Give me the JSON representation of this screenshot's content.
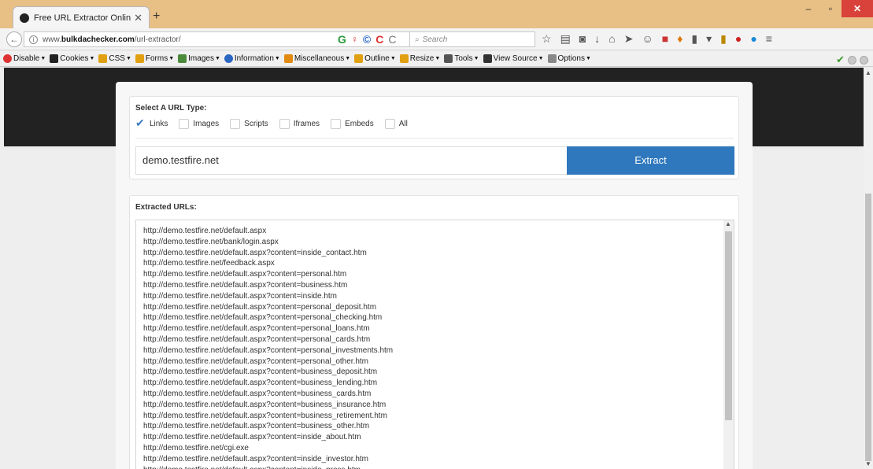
{
  "browser": {
    "tab_title": "Free URL Extractor Online ...",
    "new_tab": "+",
    "url_prefix": "www.",
    "url_domain": "bulkdachecker.com",
    "url_path": "/url-extractor/",
    "search_placeholder": "Search",
    "url_icons": [
      "G",
      "♀",
      "©",
      "C",
      "C"
    ],
    "window_controls": {
      "minimize": "–",
      "restore": "▫",
      "close": "✕"
    }
  },
  "devbar": {
    "items": [
      {
        "label": "Disable",
        "color": "#d33"
      },
      {
        "label": "Cookies",
        "color": "#222"
      },
      {
        "label": "CSS",
        "color": "#e0a010"
      },
      {
        "label": "Forms",
        "color": "#e0a010"
      },
      {
        "label": "Images",
        "color": "#4a8a3a"
      },
      {
        "label": "Information",
        "color": "#2a66c2"
      },
      {
        "label": "Miscellaneous",
        "color": "#e08a10"
      },
      {
        "label": "Outline",
        "color": "#e0a010"
      },
      {
        "label": "Resize",
        "color": "#e0a010"
      },
      {
        "label": "Tools",
        "color": "#555"
      },
      {
        "label": "View Source",
        "color": "#333"
      },
      {
        "label": "Options",
        "color": "#888"
      }
    ]
  },
  "extractor": {
    "type_label": "Select A URL Type:",
    "types": [
      {
        "label": "Links",
        "checked": true
      },
      {
        "label": "Images",
        "checked": false
      },
      {
        "label": "Scripts",
        "checked": false
      },
      {
        "label": "Iframes",
        "checked": false
      },
      {
        "label": "Embeds",
        "checked": false
      },
      {
        "label": "All",
        "checked": false
      }
    ],
    "input_value": "demo.testfire.net",
    "extract_label": "Extract",
    "results_label": "Extracted URLs:",
    "urls": [
      "http://demo.testfire.net/default.aspx",
      "http://demo.testfire.net/bank/login.aspx",
      "http://demo.testfire.net/default.aspx?content=inside_contact.htm",
      "http://demo.testfire.net/feedback.aspx",
      "http://demo.testfire.net/default.aspx?content=personal.htm",
      "http://demo.testfire.net/default.aspx?content=business.htm",
      "http://demo.testfire.net/default.aspx?content=inside.htm",
      "http://demo.testfire.net/default.aspx?content=personal_deposit.htm",
      "http://demo.testfire.net/default.aspx?content=personal_checking.htm",
      "http://demo.testfire.net/default.aspx?content=personal_loans.htm",
      "http://demo.testfire.net/default.aspx?content=personal_cards.htm",
      "http://demo.testfire.net/default.aspx?content=personal_investments.htm",
      "http://demo.testfire.net/default.aspx?content=personal_other.htm",
      "http://demo.testfire.net/default.aspx?content=business_deposit.htm",
      "http://demo.testfire.net/default.aspx?content=business_lending.htm",
      "http://demo.testfire.net/default.aspx?content=business_cards.htm",
      "http://demo.testfire.net/default.aspx?content=business_insurance.htm",
      "http://demo.testfire.net/default.aspx?content=business_retirement.htm",
      "http://demo.testfire.net/default.aspx?content=business_other.htm",
      "http://demo.testfire.net/default.aspx?content=inside_about.htm",
      "http://demo.testfire.net/cgi.exe",
      "http://demo.testfire.net/default.aspx?content=inside_investor.htm",
      "http://demo.testfire.net/default.aspx?content=inside_press.htm"
    ]
  },
  "colors": {
    "accent": "#2f78bd",
    "titlebar": "#e8bf85",
    "header_dark": "#222222"
  }
}
